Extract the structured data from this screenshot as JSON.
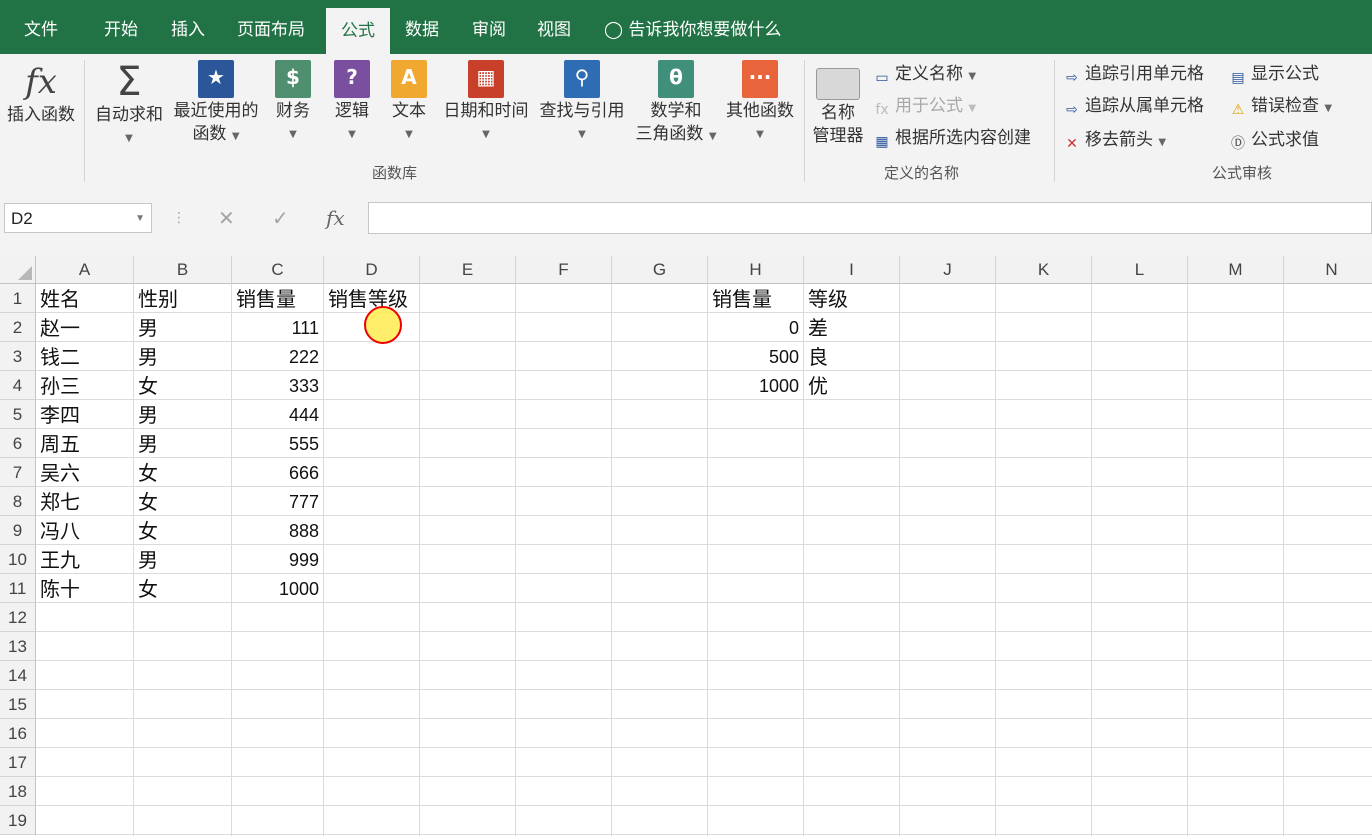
{
  "tabs": [
    "文件",
    "开始",
    "插入",
    "页面布局",
    "公式",
    "数据",
    "审阅",
    "视图"
  ],
  "active_tab": "公式",
  "tell_me": "告诉我你想要做什么",
  "ribbon": {
    "insert_function": "插入函数",
    "autosum": "自动求和",
    "recent_line1": "最近使用的",
    "recent_line2": "函数",
    "financial": "财务",
    "logical": "逻辑",
    "text": "文本",
    "datetime": "日期和时间",
    "lookup": "查找与引用",
    "math_line1": "数学和",
    "math_line2": "三角函数",
    "more": "其他函数",
    "group_library": "函数库",
    "name_manager_line1": "名称",
    "name_manager_line2": "管理器",
    "define_name": "定义名称",
    "use_in_formula": "用于公式",
    "create_from_selection": "根据所选内容创建",
    "group_defined_names": "定义的名称",
    "trace_precedents": "追踪引用单元格",
    "trace_dependents": "追踪从属单元格",
    "remove_arrows": "移去箭头",
    "show_formulas": "显示公式",
    "error_checking": "错误检查",
    "evaluate_formula": "公式求值",
    "group_auditing": "公式审核"
  },
  "formula_bar": {
    "name_box": "D2",
    "formula": ""
  },
  "columns": [
    "A",
    "B",
    "C",
    "D",
    "E",
    "F",
    "G",
    "H",
    "I",
    "J",
    "K",
    "L",
    "M",
    "N"
  ],
  "rows": [
    "1",
    "2",
    "3",
    "4",
    "5",
    "6",
    "7",
    "8",
    "9",
    "10",
    "11",
    "12",
    "13",
    "14",
    "15",
    "16",
    "17",
    "18",
    "19"
  ],
  "table": {
    "headers": [
      "姓名",
      "性别",
      "销售量",
      "销售等级"
    ],
    "names": [
      "赵一",
      "钱二",
      "孙三",
      "李四",
      "周五",
      "吴六",
      "郑七",
      "冯八",
      "王九",
      "陈十"
    ],
    "genders": [
      "男",
      "男",
      "女",
      "男",
      "男",
      "女",
      "女",
      "女",
      "男",
      "女"
    ],
    "sales": [
      "111",
      "222",
      "333",
      "444",
      "555",
      "666",
      "777",
      "888",
      "999",
      "1000"
    ]
  },
  "lookup_table": {
    "headers": [
      "销售量",
      "等级"
    ],
    "thresholds": [
      "0",
      "500",
      "1000"
    ],
    "grades": [
      "差",
      "良",
      "优"
    ]
  },
  "colors": {
    "excel_green": "#217346",
    "ribbon_bg": "#f3f3f3",
    "cursor_fill": "#ffeb50",
    "cursor_ring": "#ee0000"
  }
}
